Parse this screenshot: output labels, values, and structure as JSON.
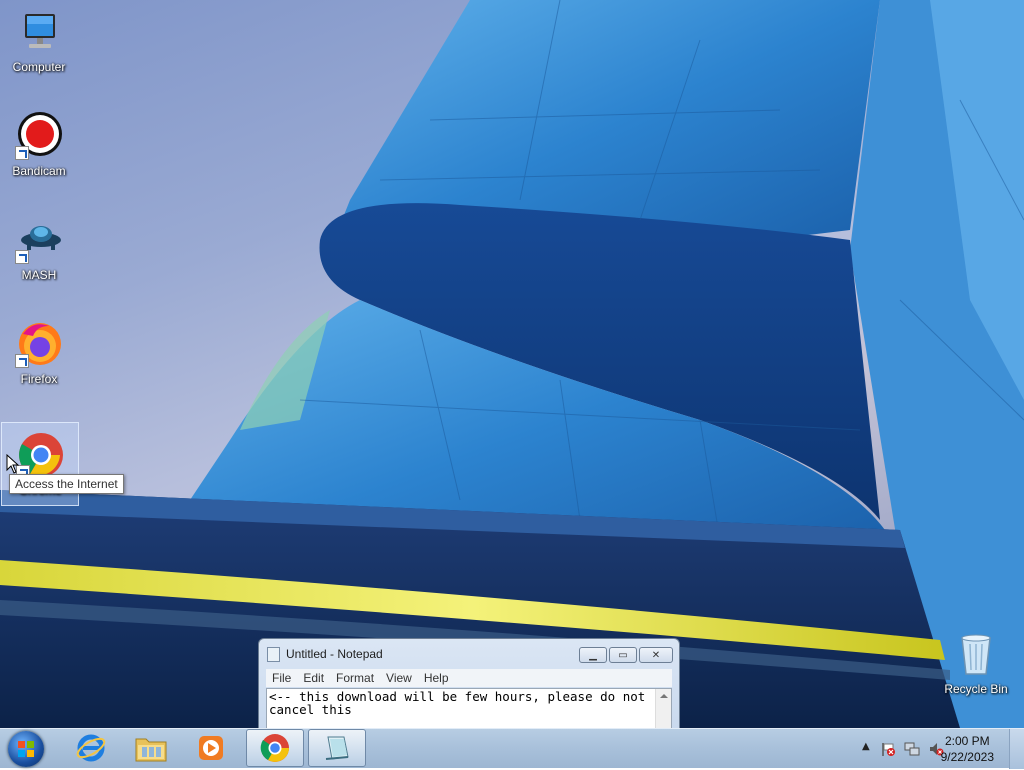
{
  "desktop": {
    "icons": [
      {
        "label": "Computer",
        "icon": "computer-icon"
      },
      {
        "label": "Bandicam",
        "icon": "bandicam-icon"
      },
      {
        "label": "MASH",
        "icon": "mash-icon"
      },
      {
        "label": "Firefox",
        "icon": "firefox-icon"
      },
      {
        "label": "Chrome",
        "icon": "chrome-icon"
      }
    ],
    "recycle_bin": {
      "label": "Recycle Bin",
      "icon": "recycle-bin-icon"
    },
    "tooltip": "Access the Internet"
  },
  "notepad": {
    "title": "Untitled - Notepad",
    "menu": [
      "File",
      "Edit",
      "Format",
      "View",
      "Help"
    ],
    "content": "<-- this download will be few hours, please do not cancel this"
  },
  "taskbar": {
    "pinned": [
      "internet-explorer-icon",
      "file-explorer-icon",
      "media-player-icon",
      "chrome-icon",
      "notepad-icon"
    ],
    "time": "2:00 PM",
    "date": "9/22/2023"
  },
  "colors": {
    "taskbar": "#a8c0da",
    "sky": "#9aaad3",
    "building": "#2f7ec8"
  }
}
